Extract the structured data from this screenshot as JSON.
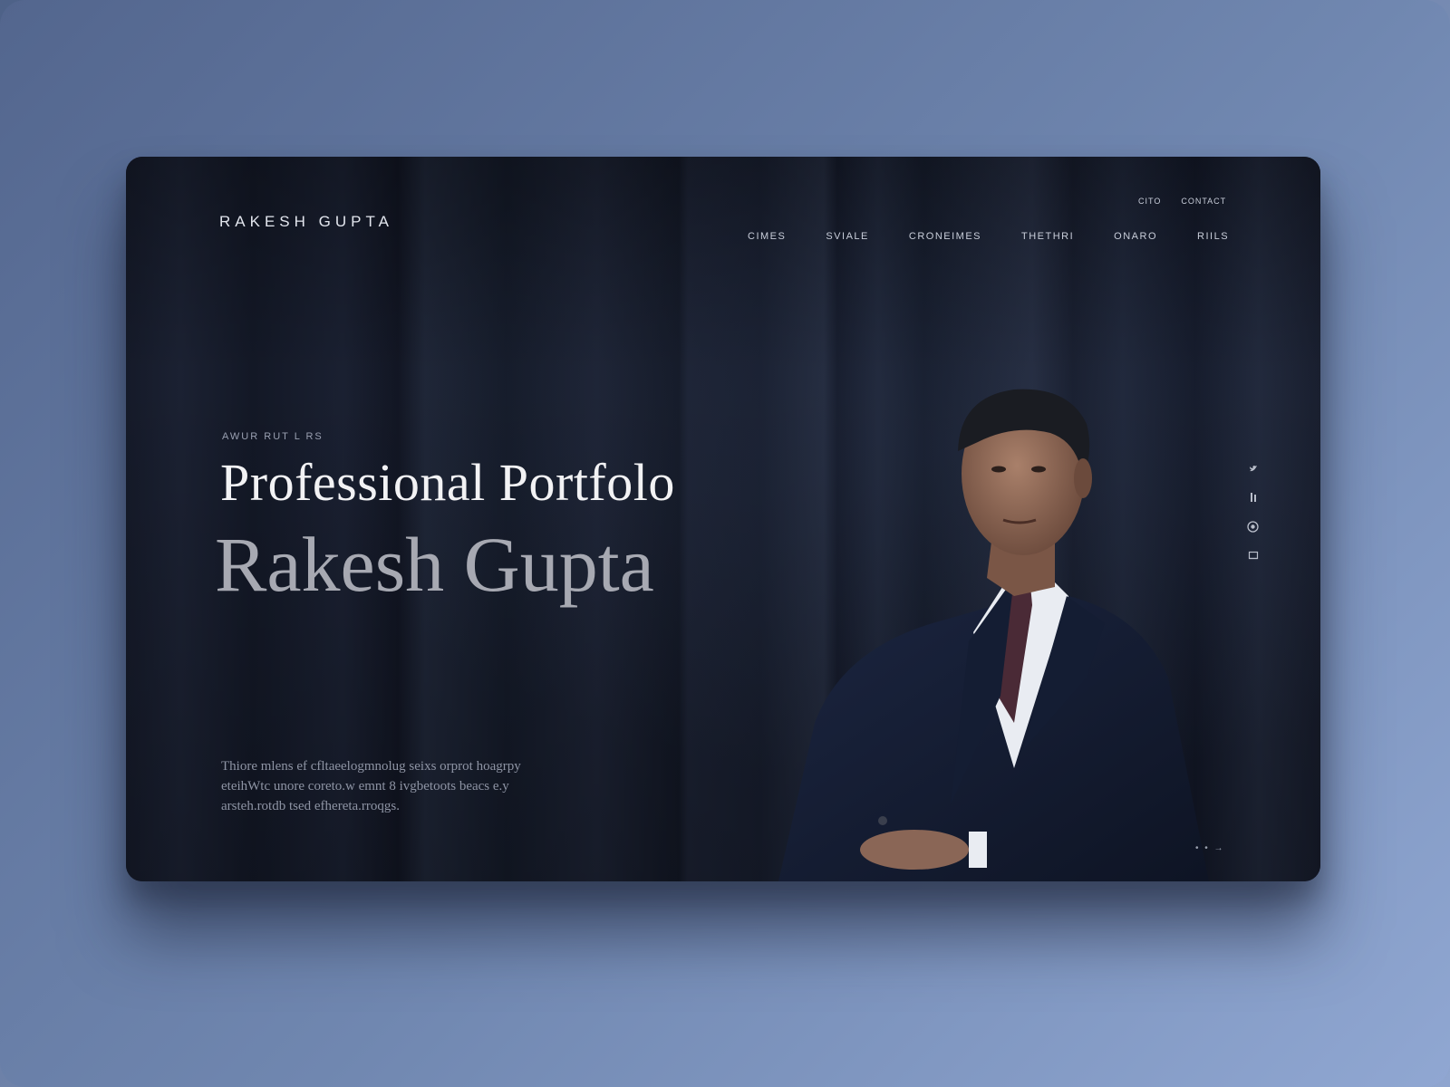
{
  "brand": "RAKESH GUPTA",
  "top_links": [
    "CITO",
    "CONTACT"
  ],
  "nav": {
    "items": [
      "CIMES",
      "SVIALE",
      "CRONEIMES",
      "THETHRI",
      "ONARO",
      "RIILS"
    ]
  },
  "hero": {
    "eyebrow": "AWUR RUT L RS",
    "headline": "Professional Portfolo",
    "name": "Rakesh Gupta",
    "intro": "Thiore mlens ef cfltaeelogmnolug seixs orprot hoagrpy eteihWtc unore coreto.w emnt 8 ivgbetoots beacs e.y arsteh.rotdb tsed efhereta.rroqgs."
  },
  "socials": [
    "twitter-icon",
    "linkedin-icon",
    "instagram-icon",
    "mail-icon"
  ],
  "scroll_hint": "• • →",
  "colors": {
    "card_bg": "#141826",
    "headline": "#f2f2f4",
    "name": "#a7a9b2",
    "page_bg_start": "#4e6288",
    "page_bg_end": "#8fa5cf"
  }
}
